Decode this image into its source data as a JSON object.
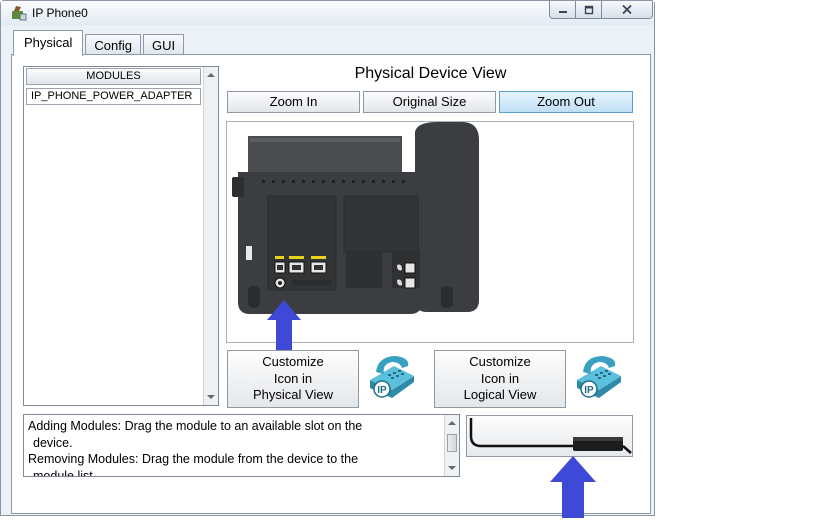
{
  "window": {
    "title": "IP Phone0",
    "controls": {
      "minimize": "▭",
      "maximize": "▢",
      "close": "✕"
    }
  },
  "tabs": [
    {
      "label": "Physical",
      "active": true
    },
    {
      "label": "Config",
      "active": false
    },
    {
      "label": "GUI",
      "active": false
    }
  ],
  "modules": {
    "header": "MODULES",
    "items": [
      "IP_PHONE_POWER_ADAPTER"
    ]
  },
  "device_view": {
    "title": "Physical Device View",
    "zoom_in": "Zoom In",
    "original_size": "Original Size",
    "zoom_out": "Zoom Out",
    "active_button": "Zoom Out"
  },
  "customize": {
    "physical": {
      "line1": "Customize",
      "line2": "Icon in",
      "line3": "Physical View"
    },
    "logical": {
      "line1": "Customize",
      "line2": "Icon in",
      "line3": "Logical View"
    }
  },
  "help": {
    "line1": "Adding Modules: Drag the module to an available slot on the",
    "line2": "device.",
    "line3": "Removing Modules: Drag the module from the device to the",
    "line4": "module list."
  },
  "colors": {
    "arrow": "#3f49d8",
    "device_body": "#3b3d40",
    "active_button": "#bfe0f5",
    "port_label": "#e8d21a"
  },
  "icons": {
    "app": "ip-phone-icon",
    "customize": "ip-phone-icon",
    "module": "power-adapter-icon"
  }
}
